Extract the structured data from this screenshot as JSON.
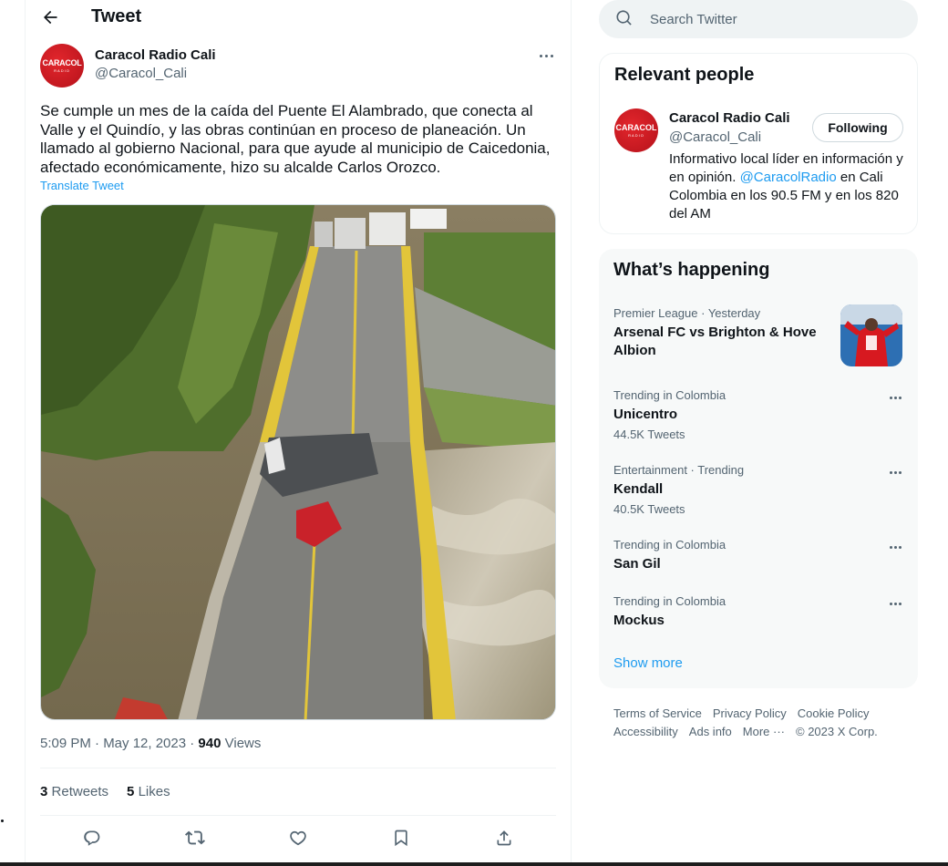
{
  "header": {
    "title": "Tweet",
    "back_icon": "arrow-left-icon"
  },
  "tweet": {
    "author_name": "Caracol Radio Cali",
    "author_handle": "@Caracol_Cali",
    "avatar_text": "CARACOL",
    "avatar_subtext": "RADIO",
    "text": "Se cumple un mes de la caída del Puente El Alambrado, que conecta al Valle y el Quindío, y las obras continúan en proceso de planeación. Un llamado al gobierno Nacional, para que ayude al municipio de Caicedonia, afectado económicamente, hizo su alcalde Carlos Orozco.",
    "translate_label": "Translate Tweet",
    "timestamp": "5:09 PM · May 12, 2023 ·",
    "views_count": "940",
    "views_label": "Views",
    "retweets_count": "3",
    "retweets_label": "Retweets",
    "likes_count": "5",
    "likes_label": "Likes"
  },
  "search": {
    "placeholder": "Search Twitter"
  },
  "relevant_people": {
    "title": "Relevant people",
    "name": "Caracol Radio Cali",
    "handle": "@Caracol_Cali",
    "follow_label": "Following",
    "bio_part1": "Informativo local líder en información y en opinión. ",
    "bio_link": "@CaracolRadio",
    "bio_part2": " en Cali Colombia en los 90.5 FM y en los 820 del AM"
  },
  "whats_happening": {
    "title": "What’s happening",
    "trends": [
      {
        "context": "Premier League · Yesterday",
        "name": "Arsenal FC vs Brighton & Hove Albion",
        "count": ""
      },
      {
        "context": "Trending in Colombia",
        "name": "Unicentro",
        "count": "44.5K Tweets"
      },
      {
        "context": "Entertainment · Trending",
        "name": "Kendall",
        "count": "40.5K Tweets"
      },
      {
        "context": "Trending in Colombia",
        "name": "San Gil",
        "count": ""
      },
      {
        "context": "Trending in Colombia",
        "name": "Mockus",
        "count": ""
      }
    ],
    "show_more": "Show more"
  },
  "footer": {
    "links": [
      "Terms of Service",
      "Privacy Policy",
      "Cookie Policy",
      "Accessibility",
      "Ads info",
      "More ···"
    ],
    "copyright": "© 2023 X Corp."
  },
  "colors": {
    "accent": "#1d9bf0",
    "text": "#0f1419",
    "muted": "#536471",
    "brand_red": "#d7161f"
  }
}
